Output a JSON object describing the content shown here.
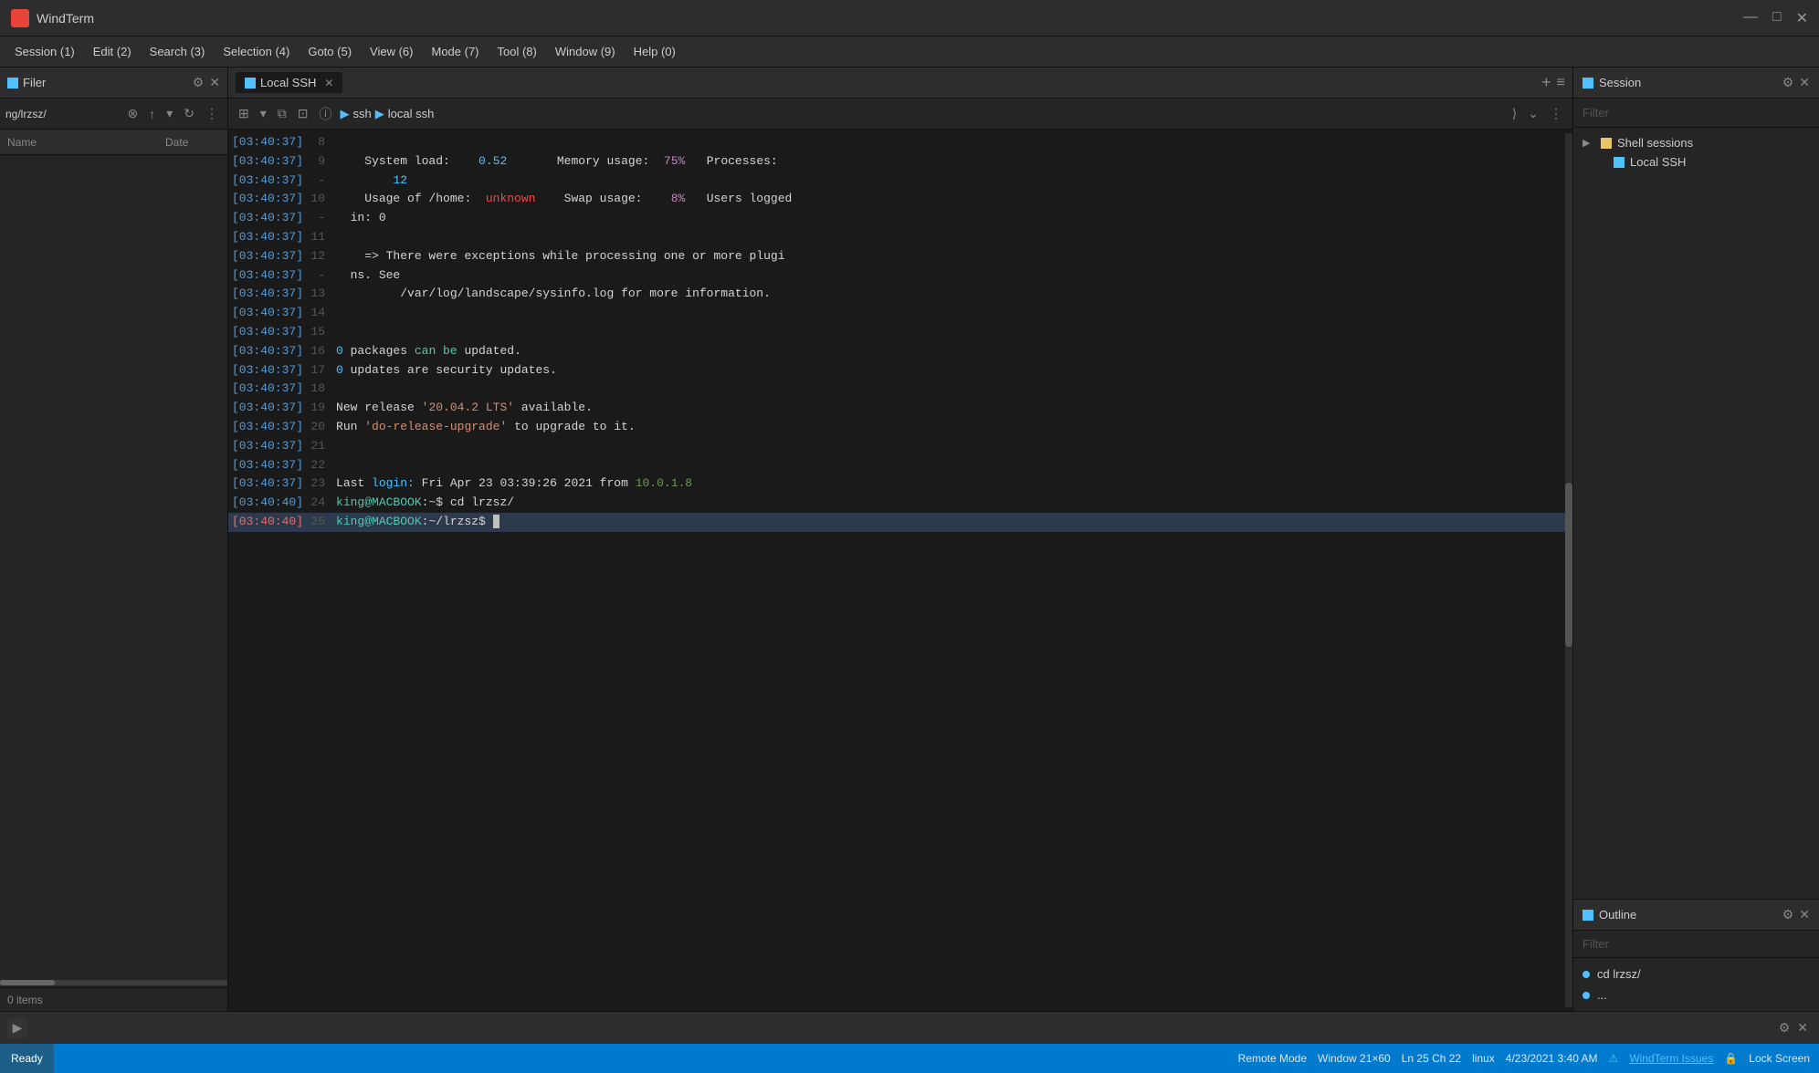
{
  "app": {
    "title": "WindTerm",
    "logo_color": "#e8443a"
  },
  "titlebar": {
    "title": "WindTerm",
    "minimize": "—",
    "maximize": "□",
    "close": "✕"
  },
  "menubar": {
    "items": [
      "Session (1)",
      "Edit (2)",
      "Search (3)",
      "Selection (4)",
      "Goto (5)",
      "View (6)",
      "Mode (7)",
      "Tool (8)",
      "Window (9)",
      "Help (0)"
    ]
  },
  "filer_panel": {
    "tab_label": "Filer",
    "path": "ng/lrzsz/",
    "col_name": "Name",
    "col_date": "Date",
    "status": "0 items",
    "close_btn": "✕",
    "settings_icon": "⚙"
  },
  "terminal_panel": {
    "tab_label": "Local SSH",
    "close_btn": "✕",
    "add_btn": "+",
    "menu_btn": "≡",
    "path_items": [
      "ssh",
      "local ssh"
    ],
    "info_icon": "ⓘ",
    "more_icon": "⋮"
  },
  "terminal_lines": [
    {
      "ts": "[03:40:37]",
      "num": "8",
      "content": "",
      "color": "txt-white"
    },
    {
      "ts": "[03:40:37]",
      "num": "9",
      "content": "    System load:    <cyan>0.52</cyan>       Memory usage:  <magenta>75%</magenta>   Processes:",
      "color": "txt-white"
    },
    {
      "ts": "[03:40:37]",
      "num": "-",
      "content": "        <cyan>12</cyan>",
      "color": "txt-white"
    },
    {
      "ts": "[03:40:37]",
      "num": "10",
      "content": "    Usage of /home:  <red>unknown</red>    Swap usage:    <magenta>8%</magenta>   Users logged",
      "color": "txt-white"
    },
    {
      "ts": "[03:40:37]",
      "num": "-",
      "content": "  in: 0",
      "color": "txt-white"
    },
    {
      "ts": "[03:40:37]",
      "num": "11",
      "content": "",
      "color": "txt-white"
    },
    {
      "ts": "[03:40:37]",
      "num": "12",
      "content": "    => There were exceptions while processing one or more plugi",
      "color": "txt-white"
    },
    {
      "ts": "[03:40:37]",
      "num": "-",
      "content": "  ns. See",
      "color": "txt-white"
    },
    {
      "ts": "[03:40:37]",
      "num": "13",
      "content": "         /var/log/landscape/sysinfo.log for more information.",
      "color": "txt-white"
    },
    {
      "ts": "[03:40:37]",
      "num": "14",
      "content": "",
      "color": "txt-white"
    },
    {
      "ts": "[03:40:37]",
      "num": "15",
      "content": "",
      "color": "txt-white"
    },
    {
      "ts": "[03:40:37]",
      "num": "16",
      "content": "<cyan>0</cyan> packages <green>can be</green> updated.",
      "color": "txt-white"
    },
    {
      "ts": "[03:40:37]",
      "num": "17",
      "content": "<cyan>0</cyan> updates are security updates.",
      "color": "txt-white"
    },
    {
      "ts": "[03:40:37]",
      "num": "18",
      "content": "",
      "color": "txt-white"
    },
    {
      "ts": "[03:40:37]",
      "num": "19",
      "content": "New release <orange>'20.04.2 LTS'</orange> available.",
      "color": "txt-white"
    },
    {
      "ts": "[03:40:37]",
      "num": "20",
      "content": "Run <orange>'do-release-upgrade'</orange> to upgrade to it.",
      "color": "txt-white"
    },
    {
      "ts": "[03:40:37]",
      "num": "21",
      "content": "",
      "color": "txt-white"
    },
    {
      "ts": "[03:40:37]",
      "num": "22",
      "content": "",
      "color": "txt-white"
    },
    {
      "ts": "[03:40:37]",
      "num": "23",
      "content": "Last <cyan>login:</cyan> Fri Apr 23 03:39:26 2021 from <bright_green>10.0.1.8</bright_green>",
      "color": "txt-white"
    },
    {
      "ts": "[03:40:40]",
      "num": "24",
      "content": "<green>king@MACBOOK</green>:~$ cd lrzsz/",
      "color": "txt-white",
      "highlighted": false
    },
    {
      "ts": "[03:40:40]",
      "num": "25",
      "content": "<green>king@MACBOOK</green>:~/lrzsz$ |",
      "color": "txt-white",
      "highlighted": true
    }
  ],
  "session_panel": {
    "title": "Session",
    "filter_placeholder": "Filter",
    "shell_sessions": "Shell sessions",
    "local_ssh": "Local SSH",
    "settings_icon": "⚙",
    "close_icon": "✕"
  },
  "outline_panel": {
    "title": "Outline",
    "filter_placeholder": "Filter",
    "items": [
      "cd lrzsz/",
      "..."
    ],
    "settings_icon": "⚙",
    "close_icon": "✕"
  },
  "bottom_panel": {
    "terminal_icon": "▶",
    "settings_icon": "⚙",
    "close_icon": "✕"
  },
  "statusbar": {
    "ready": "Ready",
    "mode": "Remote Mode",
    "window_size": "Window 21×60",
    "cursor": "Ln 25 Ch 22",
    "os": "linux",
    "datetime": "4/23/2021  3:40 AM",
    "issues": "WindTerm Issues",
    "lock": "Lock Screen"
  }
}
